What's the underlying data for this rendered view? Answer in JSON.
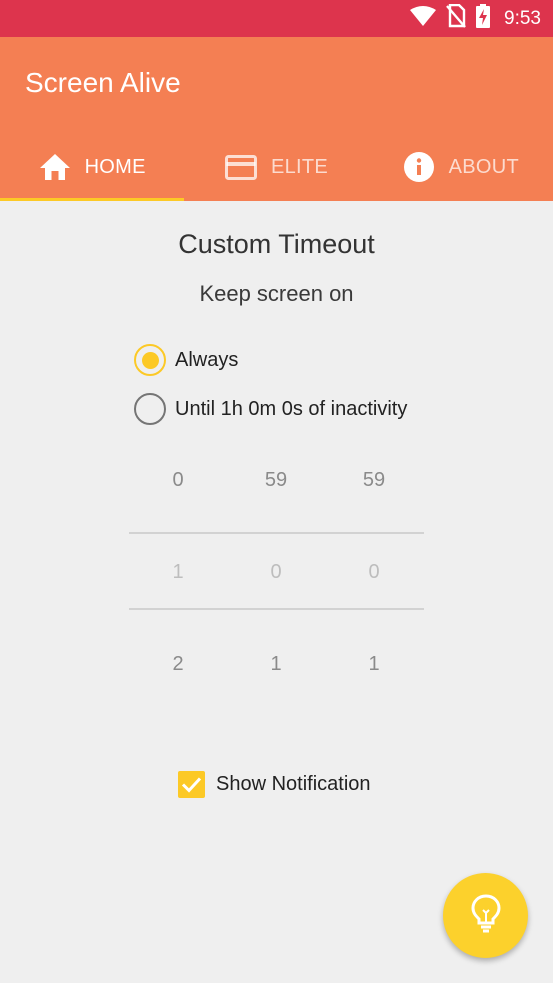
{
  "status_bar": {
    "time": "9:53",
    "icons": [
      "wifi-icon",
      "no-sim-icon",
      "battery-charging-icon"
    ],
    "background": "#dd344d"
  },
  "app_bar": {
    "title": "Screen Alive",
    "background": "#f47f53"
  },
  "tabs": [
    {
      "label": "HOME",
      "icon": "home-icon",
      "active": true
    },
    {
      "label": "ELITE",
      "icon": "card-icon",
      "active": false
    },
    {
      "label": "ABOUT",
      "icon": "info-icon",
      "active": false
    }
  ],
  "main": {
    "title": "Custom Timeout",
    "subtitle": "Keep screen on",
    "options": [
      {
        "label": "Always",
        "selected": true
      },
      {
        "label": "Until 1h 0m 0s of inactivity",
        "selected": false
      }
    ],
    "picker": {
      "hours": [
        "0",
        "1",
        "2"
      ],
      "minutes": [
        "59",
        "0",
        "1"
      ],
      "seconds": [
        "59",
        "0",
        "1"
      ]
    },
    "show_notification": {
      "label": "Show Notification",
      "checked": true
    }
  },
  "fab": {
    "icon": "lightbulb-icon"
  },
  "colors": {
    "accent": "#fcc926",
    "primary": "#f47f53",
    "status": "#dd344d"
  }
}
